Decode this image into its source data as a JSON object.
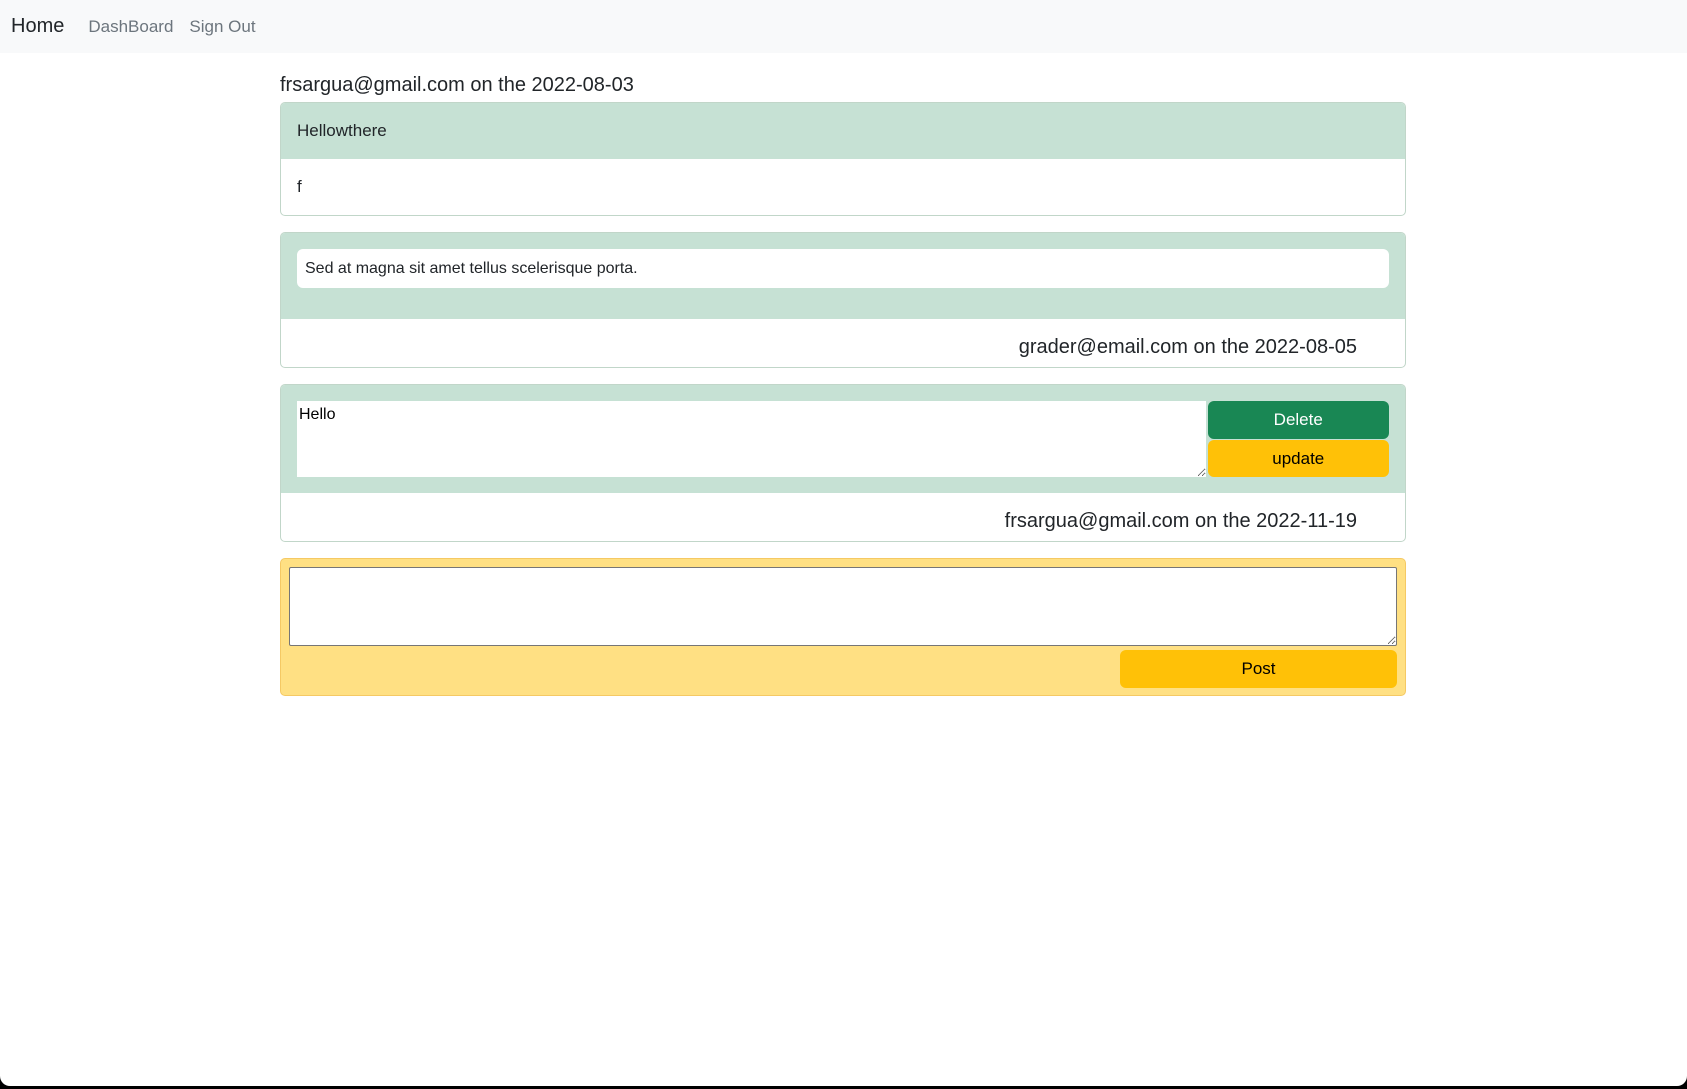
{
  "navbar": {
    "brand": "Home",
    "links": [
      "DashBoard",
      "Sign Out"
    ]
  },
  "post": {
    "meta": "frsargua@gmail.com on the 2022-08-03",
    "title": "Hellowthere",
    "body": "f"
  },
  "comments": [
    {
      "text": "Sed at magna sit amet tellus scelerisque porta.",
      "meta": "grader@email.com on the 2022-08-05"
    },
    {
      "text": "Hello",
      "meta": "frsargua@gmail.com on the 2022-11-19",
      "delete_label": "Delete",
      "update_label": "update"
    }
  ],
  "new_comment": {
    "value": "",
    "post_label": "Post"
  },
  "colors": {
    "card_header": "#c6e1d4",
    "delete_button": "#198754",
    "warning_button": "#ffc107",
    "new_comment_bg": "#ffe083"
  }
}
